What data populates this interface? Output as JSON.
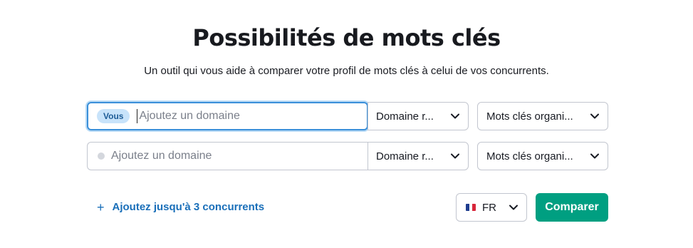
{
  "header": {
    "title": "Possibilités de mots clés",
    "subtitle": "Un outil qui vous aide à comparer votre profil de mots clés à celui de vos concurrents."
  },
  "rows": [
    {
      "badge": "Vous",
      "domain_placeholder": "Ajoutez un domaine",
      "domain_type": "Domaine r...",
      "keyword_type": "Mots clés organi..."
    },
    {
      "domain_placeholder": "Ajoutez un domaine",
      "domain_type": "Domaine r...",
      "keyword_type": "Mots clés organi..."
    }
  ],
  "actions": {
    "add_competitors_label": "Ajoutez jusqu'à 3 concurrents",
    "add_icon": "plus-icon",
    "language": "FR",
    "language_flag": "france-flag-icon",
    "compare_label": "Comparer"
  },
  "colors": {
    "accent_green": "#009f81",
    "link_blue": "#1a6fb9",
    "focus_blue": "#3a8fd9",
    "badge_bg": "#c8e3fa"
  }
}
